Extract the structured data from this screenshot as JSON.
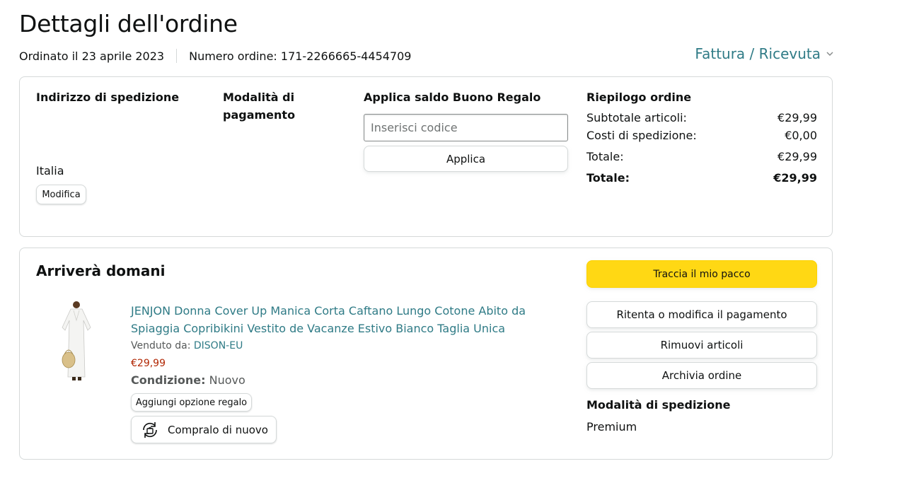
{
  "header": {
    "title": "Dettagli dell'ordine",
    "ordered_on": "Ordinato il 23 aprile 2023",
    "order_number": "Numero ordine: 171-2266665-4454709",
    "invoice_link": "Fattura / Ricevuta",
    "invoice_icon": "chevron-down-icon"
  },
  "info_box": {
    "shipping_address": {
      "heading": "Indirizzo di spedizione",
      "country": "Italia",
      "edit_label": "Modifica"
    },
    "payment": {
      "heading_line1": "Modalità di",
      "heading_line2": "pagamento"
    },
    "gift_card": {
      "heading": "Applica saldo Buono Regalo",
      "input_placeholder": "Inserisci codice",
      "input_value": "",
      "apply_label": "Applica"
    },
    "summary": {
      "heading": "Riepilogo ordine",
      "rows": [
        {
          "label": "Subtotale articoli:",
          "value": "€29,99"
        },
        {
          "label": "Costi di spedizione:",
          "value": "€0,00"
        },
        {
          "label": "Totale:",
          "value": "€29,99"
        }
      ],
      "grand_total": {
        "label": "Totale:",
        "value": "€29,99"
      }
    }
  },
  "shipment": {
    "title": "Arriverà domani",
    "product": {
      "title": "JENJON Donna Cover Up Manica Corta Caftano Lungo Cotone Abito da Spiaggia Copribikini Vestito de Vacanze Estivo Bianco Taglia Unica",
      "sold_by_label": "Venduto da:",
      "seller": "DISON-EU",
      "price": "€29,99",
      "condition_label": "Condizione:",
      "condition_value": "Nuovo",
      "gift_option_label": "Aggiungi opzione regalo",
      "buy_again_label": "Compralo di nuovo",
      "buy_again_icon": "buy-again-icon"
    },
    "actions": {
      "track": "Traccia il mio pacco",
      "retry_payment": "Ritenta o modifica il pagamento",
      "remove_items": "Rimuovi articoli",
      "archive": "Archivia ordine"
    },
    "shipping_method": {
      "heading": "Modalità di spedizione",
      "value": "Premium"
    }
  },
  "colors": {
    "link": "#2f7b86",
    "price": "#b12704",
    "primary_button": "#ffd814",
    "border": "#d5d9d9"
  }
}
